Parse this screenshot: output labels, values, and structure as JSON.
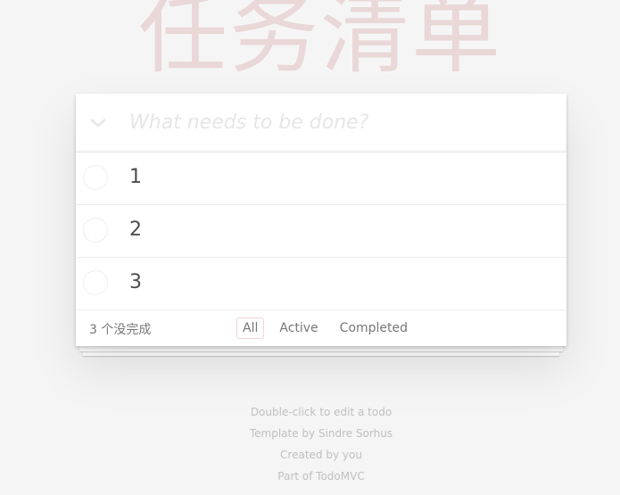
{
  "header": {
    "title": "任务清单",
    "new_todo_placeholder": "What needs to be done?",
    "toggle_all_icon": "chevron-down-icon"
  },
  "todos": [
    {
      "label": "1",
      "completed": false
    },
    {
      "label": "2",
      "completed": false
    },
    {
      "label": "3",
      "completed": false
    }
  ],
  "footer": {
    "count_text": "3 个没完成",
    "filters": [
      {
        "label": "All",
        "selected": true
      },
      {
        "label": "Active",
        "selected": false
      },
      {
        "label": "Completed",
        "selected": false
      }
    ]
  },
  "info": {
    "line1": "Double-click to edit a todo",
    "line2": "Template by Sindre Sorhus",
    "line3": "Created by you",
    "line4": "Part of TodoMVC"
  },
  "colors": {
    "title": "#e6cfcf",
    "background": "#f5f5f5",
    "selected_border": "#efd5d5"
  }
}
